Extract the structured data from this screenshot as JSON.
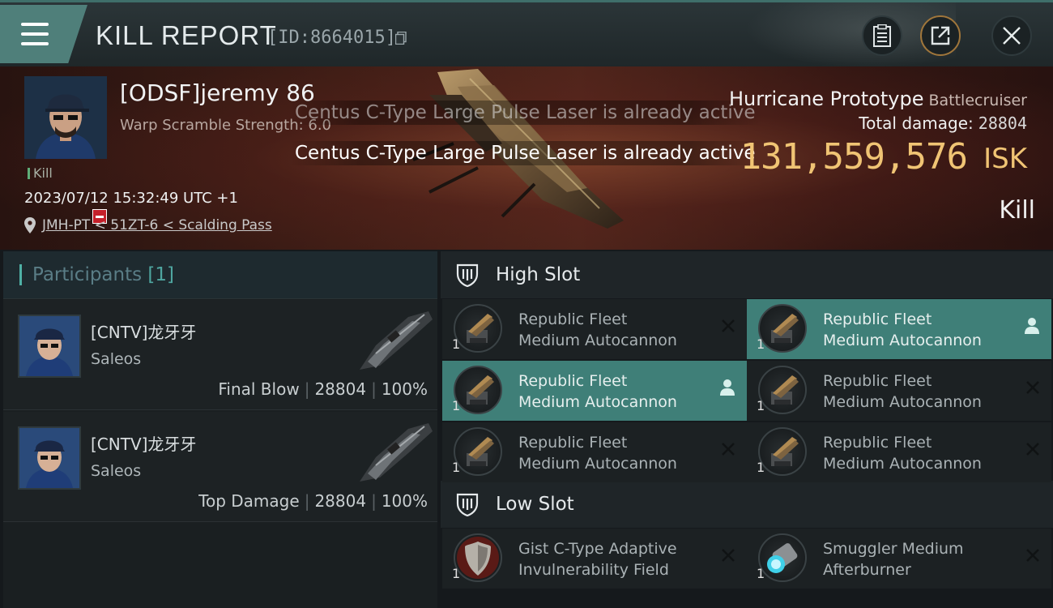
{
  "header": {
    "title": "KILL REPORT",
    "report_id": "[ID:8664015]"
  },
  "victim": {
    "name": "[ODSF]jeremy 86",
    "warp_scramble": "Warp Scramble Strength: 6.0",
    "kill_tag": "Kill",
    "datetime": "2023/07/12 15:32:49 UTC +1",
    "location": "JMH-PT < 51ZT-6 < Scalding Pass"
  },
  "toasts": [
    "Centus C-Type Large Pulse Laser is already active",
    "Centus C-Type Large Pulse Laser is already active"
  ],
  "ship": {
    "name": "Hurricane Prototype",
    "class": "Battlecruiser",
    "total_damage_label": "Total damage:",
    "total_damage": "28804",
    "isk_value": "131,559,576",
    "isk_unit": "ISK",
    "result": "Kill"
  },
  "participants": {
    "label": "Participants",
    "count": "[1]",
    "rows": [
      {
        "name": "[CNTV]龙牙牙",
        "ship": "Saleos",
        "role": "Final Blow",
        "damage": "28804",
        "percent": "100%"
      },
      {
        "name": "[CNTV]龙牙牙",
        "ship": "Saleos",
        "role": "Top Damage",
        "damage": "28804",
        "percent": "100%"
      }
    ]
  },
  "high_slot": {
    "label": "High Slot",
    "modules": [
      {
        "line1": "Republic Fleet",
        "line2": "Medium Autocannon",
        "qty": "1",
        "active": false,
        "action_icon": "close-icon"
      },
      {
        "line1": "Republic Fleet",
        "line2": "Medium Autocannon",
        "qty": "1",
        "active": true,
        "action_icon": "user-icon"
      },
      {
        "line1": "Republic Fleet",
        "line2": "Medium Autocannon",
        "qty": "1",
        "active": true,
        "action_icon": "user-icon"
      },
      {
        "line1": "Republic Fleet",
        "line2": "Medium Autocannon",
        "qty": "1",
        "active": false,
        "action_icon": "close-icon"
      },
      {
        "line1": "Republic Fleet",
        "line2": "Medium Autocannon",
        "qty": "1",
        "active": false,
        "action_icon": "close-icon"
      },
      {
        "line1": "Republic Fleet",
        "line2": "Medium Autocannon",
        "qty": "1",
        "active": false,
        "action_icon": "close-icon"
      }
    ]
  },
  "low_slot": {
    "label": "Low Slot",
    "modules": [
      {
        "line1": "Gist C-Type Adaptive",
        "line2": "Invulnerability Field",
        "qty": "1",
        "active": false,
        "action_icon": "close-icon"
      },
      {
        "line1": "Smuggler Medium",
        "line2": "Afterburner",
        "qty": "1",
        "active": false,
        "action_icon": "close-icon"
      }
    ]
  },
  "colors": {
    "accent_teal": "#3f7f78",
    "isk_gold": "#f0c474",
    "close_red": "#c4202a"
  }
}
